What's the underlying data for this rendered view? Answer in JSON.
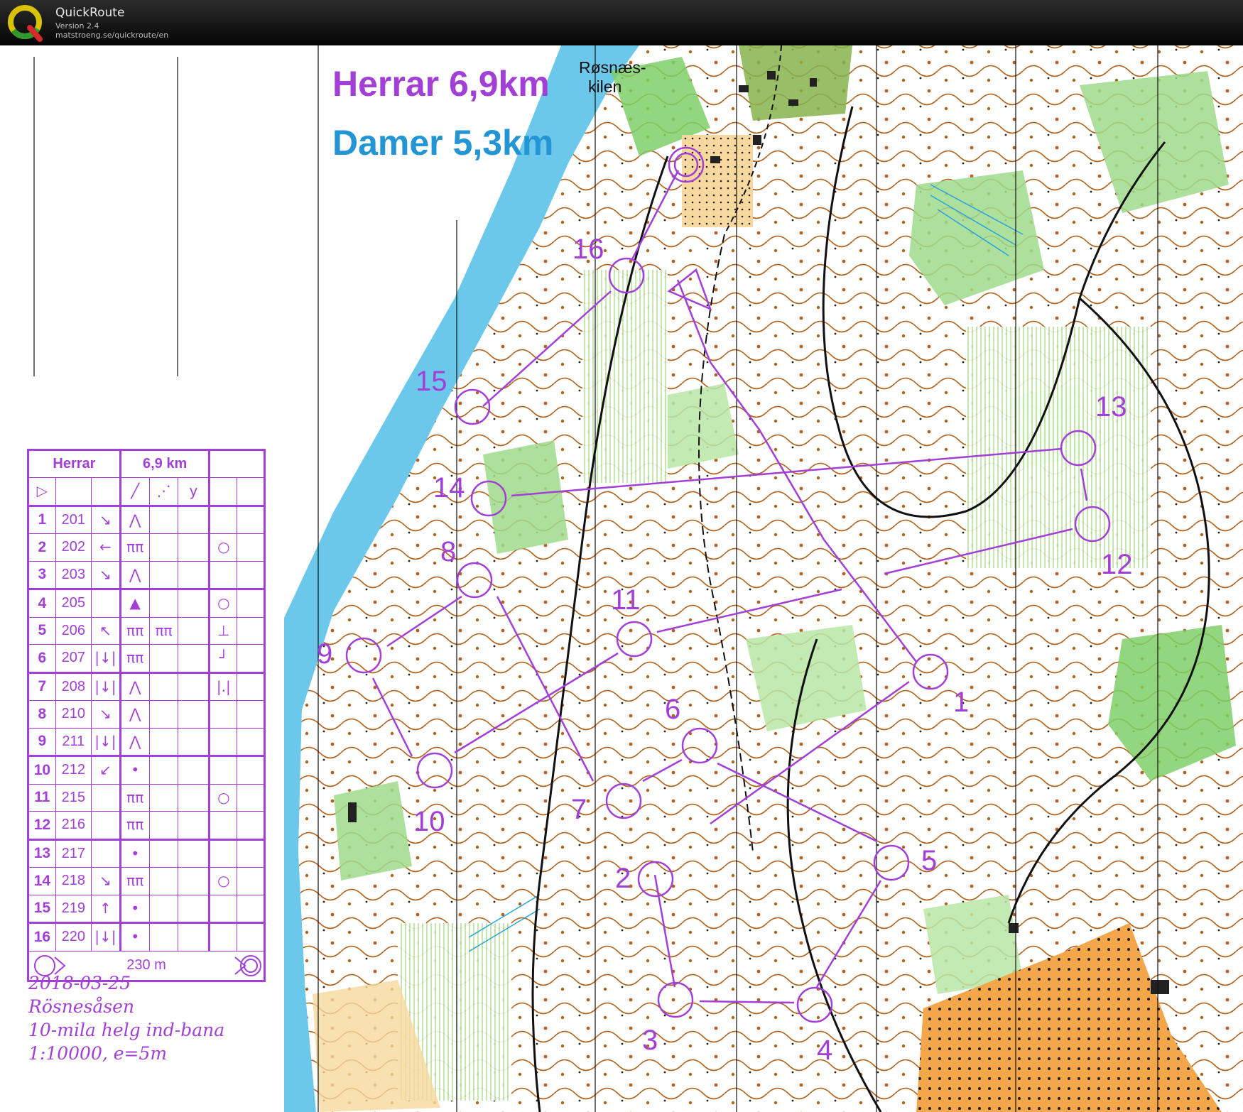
{
  "app": {
    "title": "QuickRoute",
    "version": "Version 2.4",
    "url": "matstroeng.se/quickroute/en"
  },
  "map": {
    "course_men": "Herrar 6,9km",
    "course_women": "Damer 5,3km",
    "place_name_1": "Røsnæs-",
    "place_name_2": "kilen",
    "colors": {
      "course": "#a23fd6",
      "water": "#6cc8ea",
      "forest_green": "#9fdb8c",
      "contour": "#b3621e",
      "damer_title": "#2394d4"
    },
    "controls": [
      {
        "label": "1"
      },
      {
        "label": "2"
      },
      {
        "label": "3"
      },
      {
        "label": "4"
      },
      {
        "label": "5"
      },
      {
        "label": "6"
      },
      {
        "label": "7"
      },
      {
        "label": "8"
      },
      {
        "label": "9"
      },
      {
        "label": "10"
      },
      {
        "label": "11"
      },
      {
        "label": "12"
      },
      {
        "label": "13"
      },
      {
        "label": "14"
      },
      {
        "label": "15"
      },
      {
        "label": "16"
      }
    ]
  },
  "description": {
    "course": "Herrar",
    "length": "6,9 km",
    "finish_distance": "230 m",
    "rows": [
      {
        "num": "1",
        "code": "201",
        "dir": "↘",
        "feature": "⋀",
        "detail": ""
      },
      {
        "num": "2",
        "code": "202",
        "dir": "←",
        "feature": "ππ",
        "detail": "○"
      },
      {
        "num": "3",
        "code": "203",
        "dir": "↘",
        "feature": "⋀",
        "detail": ""
      },
      {
        "num": "4",
        "code": "205",
        "dir": "",
        "feature": "▲",
        "detail": "○"
      },
      {
        "num": "5",
        "code": "206",
        "dir": "↖",
        "feature": "ππ",
        "extra": "ππ",
        "detail": "⊥"
      },
      {
        "num": "6",
        "code": "207",
        "dir": "|↓|",
        "feature": "ππ",
        "detail": "┘"
      },
      {
        "num": "7",
        "code": "208",
        "dir": "|↓|",
        "feature": "⋀",
        "detail": "|.|"
      },
      {
        "num": "8",
        "code": "210",
        "dir": "↘",
        "feature": "⋀",
        "detail": ""
      },
      {
        "num": "9",
        "code": "211",
        "dir": "|↓|",
        "feature": "⋀",
        "detail": ""
      },
      {
        "num": "10",
        "code": "212",
        "dir": "↙",
        "feature": "•",
        "detail": ""
      },
      {
        "num": "11",
        "code": "215",
        "dir": "",
        "feature": "ππ",
        "detail": "○"
      },
      {
        "num": "12",
        "code": "216",
        "dir": "",
        "feature": "ππ",
        "detail": ""
      },
      {
        "num": "13",
        "code": "217",
        "dir": "",
        "feature": "•",
        "detail": ""
      },
      {
        "num": "14",
        "code": "218",
        "dir": "↘",
        "feature": "ππ",
        "detail": "○"
      },
      {
        "num": "15",
        "code": "219",
        "dir": "↑",
        "feature": "•",
        "detail": ""
      },
      {
        "num": "16",
        "code": "220",
        "dir": "|↓|",
        "feature": "•",
        "detail": ""
      }
    ]
  },
  "notes": {
    "date": "2018-03-25",
    "area": "Rösnesåsen",
    "event": "10-mila helg ind-bana",
    "scale": "1:10000, e=5m"
  }
}
